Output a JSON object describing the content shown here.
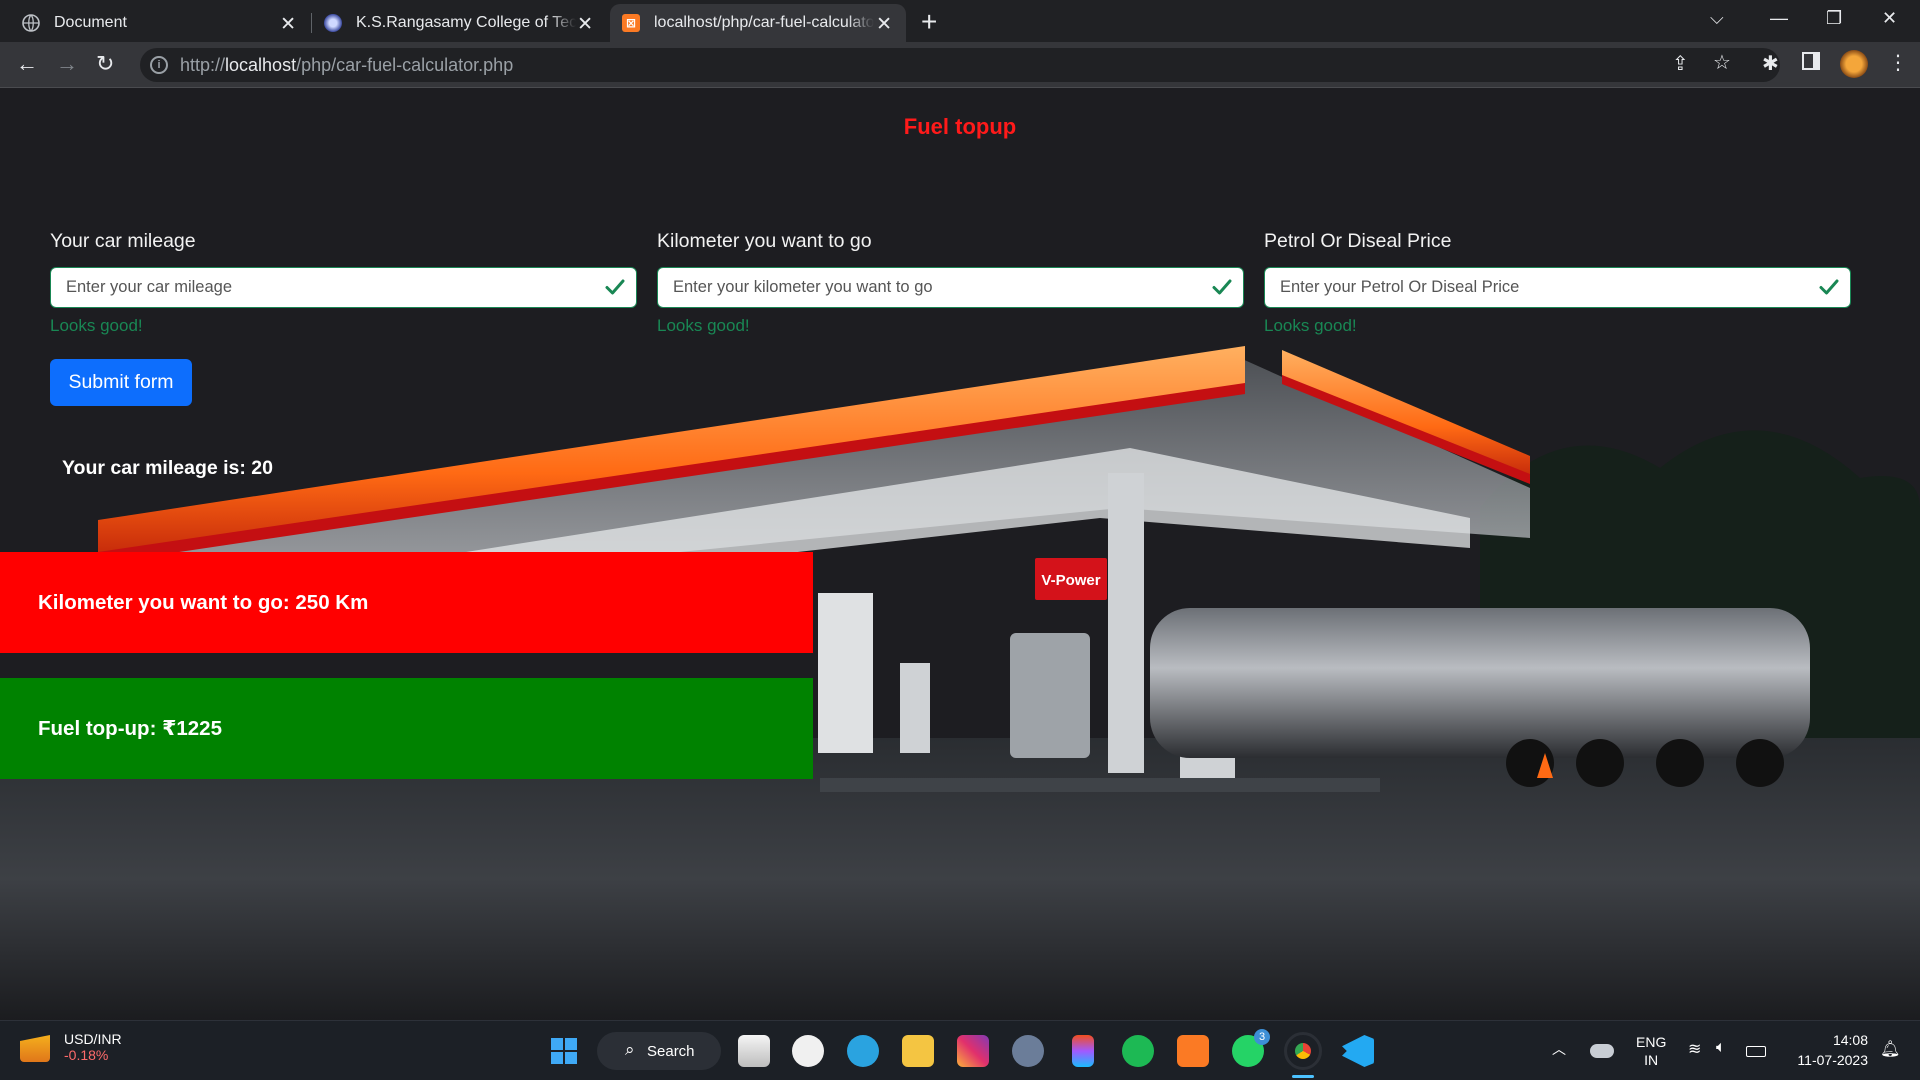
{
  "browser": {
    "tabs": [
      {
        "title": "Document",
        "icon": "globe-icon"
      },
      {
        "title": "K.S.Rangasamy College of Technology",
        "icon": "college-logo-icon"
      },
      {
        "title": "localhost/php/car-fuel-calculator.php",
        "icon": "xampp-icon"
      }
    ],
    "url_prefix": "http://",
    "url_host": "localhost",
    "url_path": "/php/car-fuel-calculator.php"
  },
  "page": {
    "heading": "Fuel topup",
    "fields": [
      {
        "label": "Your car mileage",
        "placeholder": "Enter your car mileage",
        "feedback": "Looks good!"
      },
      {
        "label": "Kilometer you want to go",
        "placeholder": "Enter your kilometer you want to go",
        "feedback": "Looks good!"
      },
      {
        "label": "Petrol Or Diseal Price",
        "placeholder": "Enter your Petrol Or Diseal Price",
        "feedback": "Looks good!"
      }
    ],
    "submit_label": "Submit form",
    "mileage_result": "Your car mileage is: 20",
    "km_result": "Kilometer you want to go: 250 Km",
    "topup_result": "Fuel top-up: ₹1225",
    "station_sign": "V-Power",
    "colors": {
      "heading": "#ff1a1a",
      "valid": "#198754",
      "primary": "#0d6efd",
      "km_box": "#ff0000",
      "topup_box": "#008200"
    }
  },
  "taskbar": {
    "ticker_label": "USD/INR",
    "ticker_change": "-0.18%",
    "search_label": "Search",
    "whatsapp_badge": "3",
    "language": "ENG",
    "region": "IN",
    "time": "14:08",
    "date": "11-07-2023"
  }
}
